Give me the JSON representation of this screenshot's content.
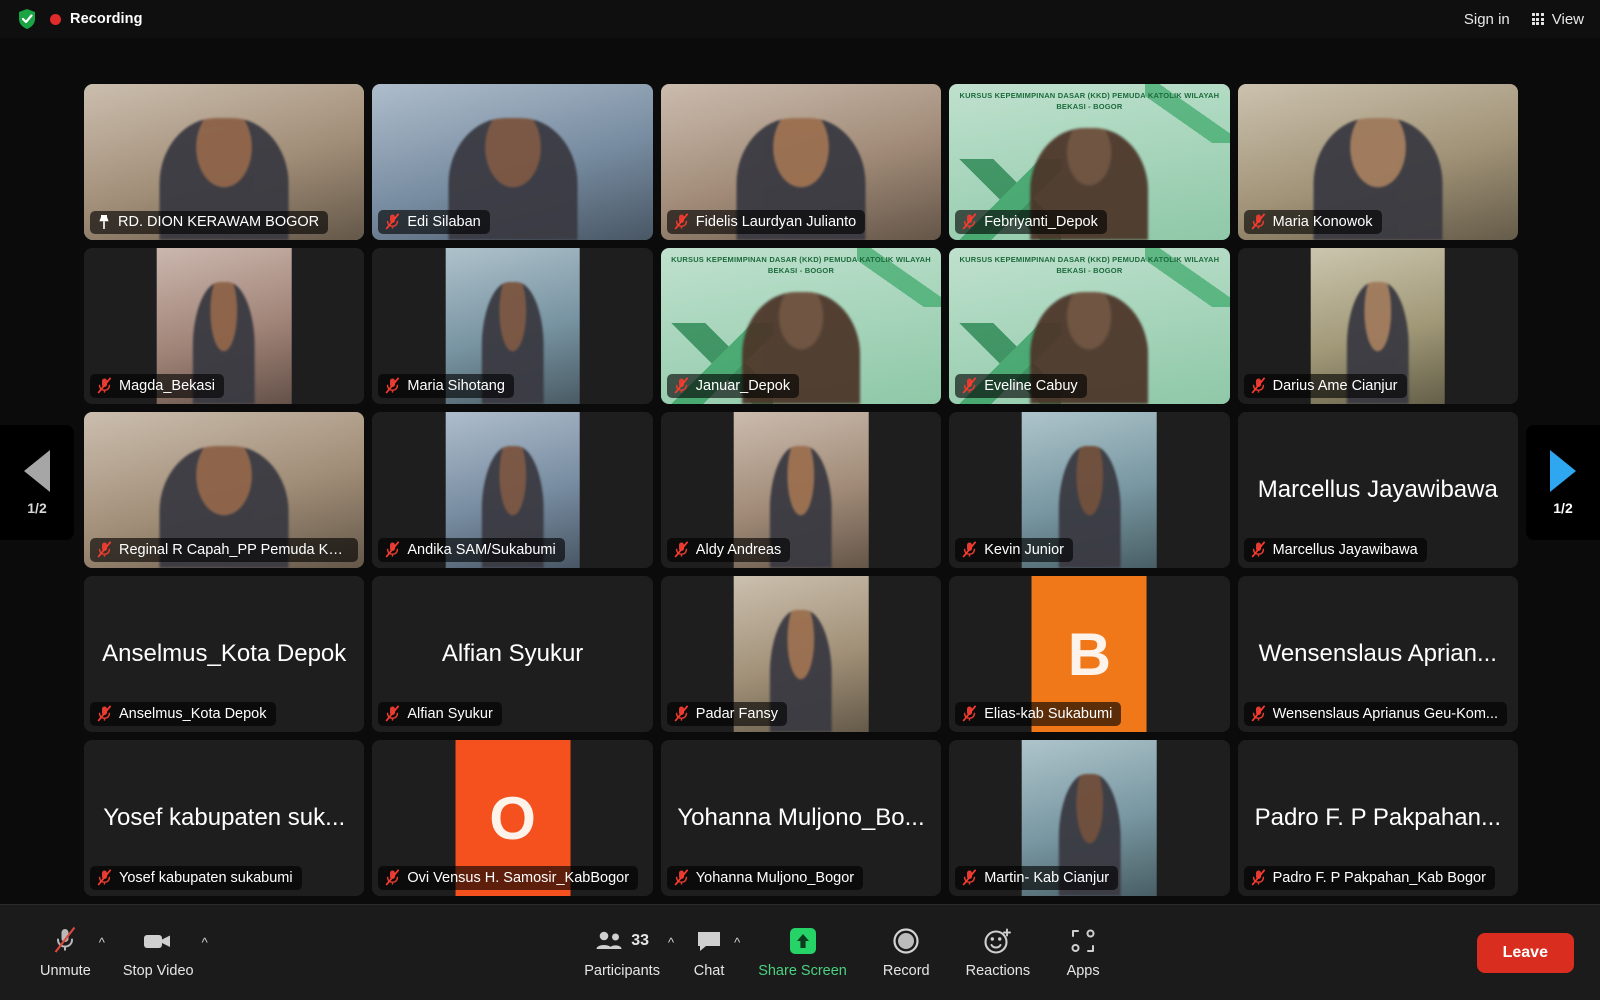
{
  "header": {
    "shield_icon": "shield-check-icon",
    "recording_label": "Recording",
    "sign_in_label": "Sign in",
    "view_label": "View",
    "view_icon": "grid-view-icon"
  },
  "pager": {
    "prev_icon": "chevron-left-triangle-icon",
    "next_icon": "chevron-right-triangle-icon",
    "prev_label": "1/2",
    "next_label": "1/2",
    "active_color": "#2ea6f0",
    "inactive_color": "#a6a6a6"
  },
  "gallery": {
    "virtual_background_text": "Kursus Kepemimpinan Dasar (KKD) Pemuda Katolik Wilayah Bekasi - Bogor",
    "active_speaker_border_color": "#37c871",
    "tiles": [
      {
        "name": "RD. DION KERAWAM BOGOR",
        "status_icon": "pin-icon",
        "kind": "video",
        "active": true,
        "big_name": ""
      },
      {
        "name": "Edi Silaban",
        "status_icon": "mic-muted-icon",
        "kind": "video",
        "active": false,
        "big_name": ""
      },
      {
        "name": "Fidelis Laurdyan Julianto",
        "status_icon": "mic-muted-icon",
        "kind": "video",
        "active": false,
        "big_name": ""
      },
      {
        "name": "Febriyanti_Depok",
        "status_icon": "mic-muted-icon",
        "kind": "vbg",
        "active": false,
        "big_name": ""
      },
      {
        "name": "Maria Konowok",
        "status_icon": "mic-muted-icon",
        "kind": "video",
        "active": false,
        "big_name": ""
      },
      {
        "name": "Magda_Bekasi",
        "status_icon": "mic-muted-icon",
        "kind": "portrait",
        "active": false,
        "big_name": ""
      },
      {
        "name": "Maria Sihotang",
        "status_icon": "mic-muted-icon",
        "kind": "portrait",
        "active": false,
        "big_name": ""
      },
      {
        "name": "Januar_Depok",
        "status_icon": "mic-muted-icon",
        "kind": "vbg",
        "active": false,
        "big_name": ""
      },
      {
        "name": "Eveline Cabuy",
        "status_icon": "mic-muted-icon",
        "kind": "vbg",
        "active": false,
        "big_name": ""
      },
      {
        "name": "Darius Ame Cianjur",
        "status_icon": "mic-muted-icon",
        "kind": "portrait",
        "active": false,
        "big_name": ""
      },
      {
        "name": "Reginal R Capah_PP Pemuda Kat...",
        "status_icon": "mic-muted-icon",
        "kind": "video",
        "active": false,
        "big_name": ""
      },
      {
        "name": "Andika SAM/Sukabumi",
        "status_icon": "mic-muted-icon",
        "kind": "portrait",
        "active": false,
        "big_name": ""
      },
      {
        "name": "Aldy Andreas",
        "status_icon": "mic-muted-icon",
        "kind": "portrait",
        "active": false,
        "big_name": ""
      },
      {
        "name": "Kevin Junior",
        "status_icon": "mic-muted-icon",
        "kind": "portrait",
        "active": false,
        "big_name": ""
      },
      {
        "name": "Marcellus Jayawibawa",
        "status_icon": "mic-muted-icon",
        "kind": "name-only",
        "active": false,
        "big_name": "Marcellus Jayawibawa"
      },
      {
        "name": "Anselmus_Kota Depok",
        "status_icon": "mic-muted-icon",
        "kind": "name-only",
        "active": false,
        "big_name": "Anselmus_Kota Depok"
      },
      {
        "name": "Alfian Syukur",
        "status_icon": "mic-muted-icon",
        "kind": "name-only",
        "active": false,
        "big_name": "Alfian Syukur"
      },
      {
        "name": "Padar Fansy",
        "status_icon": "mic-muted-icon",
        "kind": "portrait",
        "active": false,
        "big_name": ""
      },
      {
        "name": "Elias-kab Sukabumi",
        "status_icon": "mic-muted-icon",
        "kind": "letter",
        "active": false,
        "big_name": "",
        "letter": "B",
        "avatar_color": "#f07818"
      },
      {
        "name": "Wensenslaus Aprianus Geu-Kom...",
        "status_icon": "mic-muted-icon",
        "kind": "name-only",
        "active": false,
        "big_name": "Wensenslaus Aprian..."
      },
      {
        "name": "Yosef kabupaten sukabumi",
        "status_icon": "mic-muted-icon",
        "kind": "name-only",
        "active": false,
        "big_name": "Yosef kabupaten suk..."
      },
      {
        "name": "Ovi Vensus H. Samosir_KabBogor",
        "status_icon": "mic-muted-icon",
        "kind": "letter",
        "active": false,
        "big_name": "",
        "letter": "O",
        "avatar_color": "#f4511e"
      },
      {
        "name": "Yohanna Muljono_Bogor",
        "status_icon": "mic-muted-icon",
        "kind": "name-only",
        "active": false,
        "big_name": "Yohanna Muljono_Bo..."
      },
      {
        "name": "Martin- Kab Cianjur",
        "status_icon": "mic-muted-icon",
        "kind": "portrait",
        "active": false,
        "big_name": ""
      },
      {
        "name": "Padro F. P Pakpahan_Kab Bogor",
        "status_icon": "mic-muted-icon",
        "kind": "name-only",
        "active": false,
        "big_name": "Padro F. P Pakpahan..."
      }
    ]
  },
  "toolbar": {
    "unmute": {
      "label": "Unmute",
      "icon": "microphone-muted-icon",
      "caret": "audio-options-caret-icon"
    },
    "stop_video": {
      "label": "Stop Video",
      "icon": "camera-icon",
      "caret": "video-options-caret-icon"
    },
    "participants": {
      "label": "Participants",
      "icon": "participants-icon",
      "count": "33",
      "caret": "participants-options-caret-icon"
    },
    "chat": {
      "label": "Chat",
      "icon": "chat-bubble-icon",
      "caret": "chat-options-caret-icon"
    },
    "share_screen": {
      "label": "Share Screen",
      "icon": "share-screen-icon",
      "color": "#4ad17f"
    },
    "record": {
      "label": "Record",
      "icon": "record-circle-icon"
    },
    "reactions": {
      "label": "Reactions",
      "icon": "reactions-smiley-icon"
    },
    "apps": {
      "label": "Apps",
      "icon": "apps-icon"
    },
    "leave": {
      "label": "Leave",
      "color": "#d92d20"
    }
  }
}
